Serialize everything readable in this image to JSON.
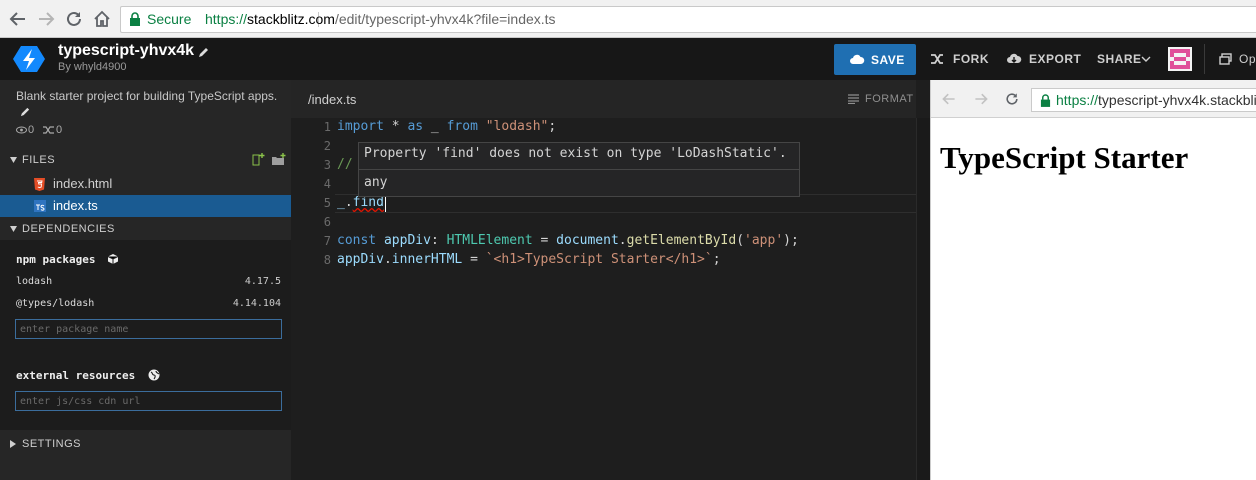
{
  "browser": {
    "secure_label": "Secure",
    "url_protocol": "https://",
    "url_host": "stackblitz.com",
    "url_path": "/edit/typescript-yhvx4k?file=index.ts",
    "icons": [
      "back-icon",
      "forward-icon",
      "reload-icon",
      "home-icon",
      "lock-icon"
    ]
  },
  "app": {
    "project_name": "typescript-yhvx4k",
    "author": "By whyld4900",
    "actions": {
      "save": "SAVE",
      "fork": "FORK",
      "export": "EXPORT",
      "share": "SHARE",
      "open": "Op"
    },
    "accent_color": "#1f6fb2"
  },
  "sidebar": {
    "description": "Blank starter project for building TypeScript apps.",
    "views": "0",
    "forks": "0",
    "files_header": "FILES",
    "files": [
      {
        "name": "index.html",
        "icon": "html5-icon",
        "selected": false
      },
      {
        "name": "index.ts",
        "icon": "typescript-file-icon",
        "selected": true
      }
    ],
    "dependencies_header": "DEPENDENCIES",
    "npm_title": "npm packages",
    "packages": [
      {
        "name": "lodash",
        "version": "4.17.5"
      },
      {
        "name": "@types/lodash",
        "version": "4.14.104"
      }
    ],
    "package_placeholder": "enter package name",
    "external_title": "external resources",
    "cdn_placeholder": "enter js/css cdn url",
    "settings_header": "SETTINGS"
  },
  "editor": {
    "tab": "/index.ts",
    "format_label": "FORMAT",
    "line_numbers": [
      "1",
      "2",
      "3",
      "4",
      "5",
      "6",
      "7",
      "8"
    ],
    "lines": {
      "l1": {
        "a": "import",
        "b": " * ",
        "c": "as",
        "d": " _ ",
        "e": "from",
        "f": " ",
        "g": "\"lodash\"",
        "h": ";"
      },
      "l3": "// ",
      "l5": {
        "a": "_",
        "b": ".",
        "c": "find"
      },
      "l7": {
        "a": "const",
        "b": " ",
        "c": "appDiv",
        "d": ": ",
        "e": "HTMLElement",
        "f": " = ",
        "g": "document",
        "h": ".",
        "i": "getElementById",
        "j": "(",
        "k": "'app'",
        "l": ");"
      },
      "l8": {
        "a": "appDiv",
        "b": ".",
        "c": "innerHTML",
        "d": " = ",
        "e": "`<h1>TypeScript Starter</h1>`",
        "f": ";"
      }
    },
    "tooltip": {
      "message": "Property 'find' does not exist on type 'LoDashStatic'.",
      "type": "any"
    }
  },
  "preview": {
    "url_protocol": "https://",
    "url_host": "typescript-yhvx4k.stackbli",
    "heading": "TypeScript Starter"
  }
}
